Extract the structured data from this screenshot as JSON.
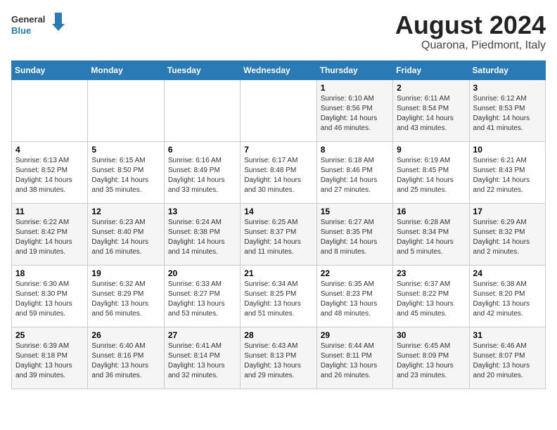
{
  "header": {
    "logo_line1": "General",
    "logo_line2": "Blue",
    "title": "August 2024",
    "subtitle": "Quarona, Piedmont, Italy"
  },
  "days_of_week": [
    "Sunday",
    "Monday",
    "Tuesday",
    "Wednesday",
    "Thursday",
    "Friday",
    "Saturday"
  ],
  "weeks": [
    [
      {
        "day": "",
        "info": ""
      },
      {
        "day": "",
        "info": ""
      },
      {
        "day": "",
        "info": ""
      },
      {
        "day": "",
        "info": ""
      },
      {
        "day": "1",
        "info": "Sunrise: 6:10 AM\nSunset: 8:56 PM\nDaylight: 14 hours and 46 minutes."
      },
      {
        "day": "2",
        "info": "Sunrise: 6:11 AM\nSunset: 8:54 PM\nDaylight: 14 hours and 43 minutes."
      },
      {
        "day": "3",
        "info": "Sunrise: 6:12 AM\nSunset: 8:53 PM\nDaylight: 14 hours and 41 minutes."
      }
    ],
    [
      {
        "day": "4",
        "info": "Sunrise: 6:13 AM\nSunset: 8:52 PM\nDaylight: 14 hours and 38 minutes."
      },
      {
        "day": "5",
        "info": "Sunrise: 6:15 AM\nSunset: 8:50 PM\nDaylight: 14 hours and 35 minutes."
      },
      {
        "day": "6",
        "info": "Sunrise: 6:16 AM\nSunset: 8:49 PM\nDaylight: 14 hours and 33 minutes."
      },
      {
        "day": "7",
        "info": "Sunrise: 6:17 AM\nSunset: 8:48 PM\nDaylight: 14 hours and 30 minutes."
      },
      {
        "day": "8",
        "info": "Sunrise: 6:18 AM\nSunset: 8:46 PM\nDaylight: 14 hours and 27 minutes."
      },
      {
        "day": "9",
        "info": "Sunrise: 6:19 AM\nSunset: 8:45 PM\nDaylight: 14 hours and 25 minutes."
      },
      {
        "day": "10",
        "info": "Sunrise: 6:21 AM\nSunset: 8:43 PM\nDaylight: 14 hours and 22 minutes."
      }
    ],
    [
      {
        "day": "11",
        "info": "Sunrise: 6:22 AM\nSunset: 8:42 PM\nDaylight: 14 hours and 19 minutes."
      },
      {
        "day": "12",
        "info": "Sunrise: 6:23 AM\nSunset: 8:40 PM\nDaylight: 14 hours and 16 minutes."
      },
      {
        "day": "13",
        "info": "Sunrise: 6:24 AM\nSunset: 8:38 PM\nDaylight: 14 hours and 14 minutes."
      },
      {
        "day": "14",
        "info": "Sunrise: 6:25 AM\nSunset: 8:37 PM\nDaylight: 14 hours and 11 minutes."
      },
      {
        "day": "15",
        "info": "Sunrise: 6:27 AM\nSunset: 8:35 PM\nDaylight: 14 hours and 8 minutes."
      },
      {
        "day": "16",
        "info": "Sunrise: 6:28 AM\nSunset: 8:34 PM\nDaylight: 14 hours and 5 minutes."
      },
      {
        "day": "17",
        "info": "Sunrise: 6:29 AM\nSunset: 8:32 PM\nDaylight: 14 hours and 2 minutes."
      }
    ],
    [
      {
        "day": "18",
        "info": "Sunrise: 6:30 AM\nSunset: 8:30 PM\nDaylight: 13 hours and 59 minutes."
      },
      {
        "day": "19",
        "info": "Sunrise: 6:32 AM\nSunset: 8:29 PM\nDaylight: 13 hours and 56 minutes."
      },
      {
        "day": "20",
        "info": "Sunrise: 6:33 AM\nSunset: 8:27 PM\nDaylight: 13 hours and 53 minutes."
      },
      {
        "day": "21",
        "info": "Sunrise: 6:34 AM\nSunset: 8:25 PM\nDaylight: 13 hours and 51 minutes."
      },
      {
        "day": "22",
        "info": "Sunrise: 6:35 AM\nSunset: 8:23 PM\nDaylight: 13 hours and 48 minutes."
      },
      {
        "day": "23",
        "info": "Sunrise: 6:37 AM\nSunset: 8:22 PM\nDaylight: 13 hours and 45 minutes."
      },
      {
        "day": "24",
        "info": "Sunrise: 6:38 AM\nSunset: 8:20 PM\nDaylight: 13 hours and 42 minutes."
      }
    ],
    [
      {
        "day": "25",
        "info": "Sunrise: 6:39 AM\nSunset: 8:18 PM\nDaylight: 13 hours and 39 minutes."
      },
      {
        "day": "26",
        "info": "Sunrise: 6:40 AM\nSunset: 8:16 PM\nDaylight: 13 hours and 36 minutes."
      },
      {
        "day": "27",
        "info": "Sunrise: 6:41 AM\nSunset: 8:14 PM\nDaylight: 13 hours and 32 minutes."
      },
      {
        "day": "28",
        "info": "Sunrise: 6:43 AM\nSunset: 8:13 PM\nDaylight: 13 hours and 29 minutes."
      },
      {
        "day": "29",
        "info": "Sunrise: 6:44 AM\nSunset: 8:11 PM\nDaylight: 13 hours and 26 minutes."
      },
      {
        "day": "30",
        "info": "Sunrise: 6:45 AM\nSunset: 8:09 PM\nDaylight: 13 hours and 23 minutes."
      },
      {
        "day": "31",
        "info": "Sunrise: 6:46 AM\nSunset: 8:07 PM\nDaylight: 13 hours and 20 minutes."
      }
    ]
  ]
}
